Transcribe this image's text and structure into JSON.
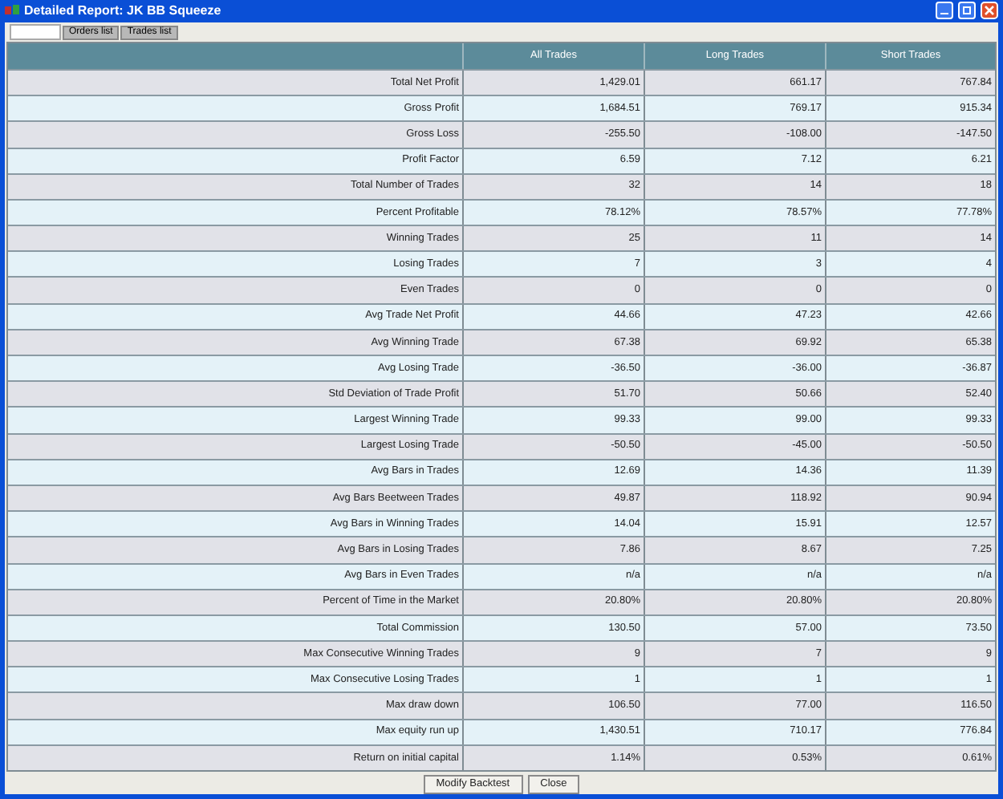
{
  "window": {
    "title": "Detailed Report: JK BB Squeeze"
  },
  "tabs": [
    {
      "selected": true
    },
    {
      "label": "Orders list",
      "selected": false
    },
    {
      "label": "Trades list",
      "selected": false
    }
  ],
  "table": {
    "columns": [
      "All Trades",
      "Long Trades",
      "Short Trades"
    ],
    "rows": [
      [
        "Total Net Profit",
        "1,429.01",
        "661.17",
        "767.84"
      ],
      [
        "Gross Profit",
        "1,684.51",
        "769.17",
        "915.34"
      ],
      [
        "Gross Loss",
        "-255.50",
        "-108.00",
        "-147.50"
      ],
      [
        "Profit Factor",
        "6.59",
        "7.12",
        "6.21"
      ],
      [
        "Total Number of Trades",
        "32",
        "14",
        "18"
      ],
      [
        "Percent Profitable",
        "78.12%",
        "78.57%",
        "77.78%"
      ],
      [
        "Winning Trades",
        "25",
        "11",
        "14"
      ],
      [
        "Losing Trades",
        "7",
        "3",
        "4"
      ],
      [
        "Even Trades",
        "0",
        "0",
        "0"
      ],
      [
        "Avg Trade Net Profit",
        "44.66",
        "47.23",
        "42.66"
      ],
      [
        "Avg Winning Trade",
        "67.38",
        "69.92",
        "65.38"
      ],
      [
        "Avg Losing Trade",
        "-36.50",
        "-36.00",
        "-36.87"
      ],
      [
        "Std Deviation of Trade Profit",
        "51.70",
        "50.66",
        "52.40"
      ],
      [
        "Largest Winning Trade",
        "99.33",
        "99.00",
        "99.33"
      ],
      [
        "Largest Losing Trade",
        "-50.50",
        "-45.00",
        "-50.50"
      ],
      [
        "Avg Bars in Trades",
        "12.69",
        "14.36",
        "11.39"
      ],
      [
        "Avg Bars Beetween Trades",
        "49.87",
        "118.92",
        "90.94"
      ],
      [
        "Avg Bars in Winning Trades",
        "14.04",
        "15.91",
        "12.57"
      ],
      [
        "Avg Bars in Losing Trades",
        "7.86",
        "8.67",
        "7.25"
      ],
      [
        "Avg Bars in Even Trades",
        "n/a",
        "n/a",
        "n/a"
      ],
      [
        "Percent of Time in the Market",
        "20.80%",
        "20.80%",
        "20.80%"
      ],
      [
        "Total Commission",
        "130.50",
        "57.00",
        "73.50"
      ],
      [
        "Max Consecutive Winning Trades",
        "9",
        "7",
        "9"
      ],
      [
        "Max Consecutive Losing Trades",
        "1",
        "1",
        "1"
      ],
      [
        "Max draw down",
        "106.50",
        "77.00",
        "116.50"
      ],
      [
        "Max equity run up",
        "1,430.51",
        "710.17",
        "776.84"
      ],
      [
        "Return on initial capital",
        "1.14%",
        "0.53%",
        "0.61%"
      ]
    ]
  },
  "buttons": [
    "Modify Backtest",
    "Close"
  ]
}
